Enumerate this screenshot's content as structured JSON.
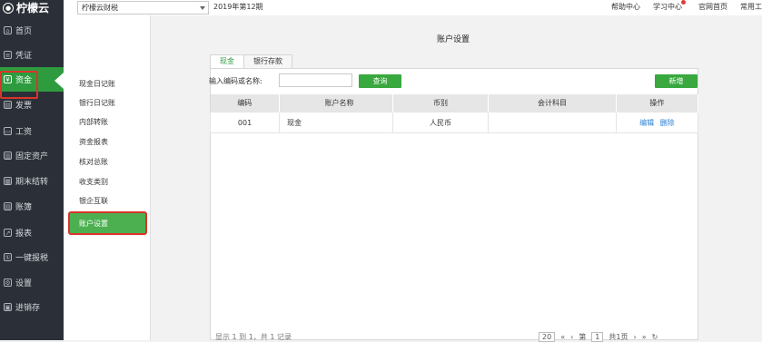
{
  "app": {
    "logo_text": "柠檬云"
  },
  "sidebar": {
    "items": [
      {
        "label": "首页",
        "icon": "home-icon",
        "glyph": "⌂"
      },
      {
        "label": "凭证",
        "icon": "voucher-icon",
        "glyph": "≡"
      },
      {
        "label": "资金",
        "icon": "funds-icon",
        "glyph": "¥"
      },
      {
        "label": "发票",
        "icon": "invoice-icon",
        "glyph": "▤"
      },
      {
        "label": "工资",
        "icon": "salary-icon",
        "glyph": "▭"
      },
      {
        "label": "固定资产",
        "icon": "assets-icon",
        "glyph": "▥"
      },
      {
        "label": "期末结转",
        "icon": "period-end-icon",
        "glyph": "▦"
      },
      {
        "label": "账簿",
        "icon": "ledger-icon",
        "glyph": "▤"
      },
      {
        "label": "报表",
        "icon": "report-icon",
        "glyph": "↗"
      },
      {
        "label": "一键报税",
        "icon": "tax-icon",
        "glyph": "①"
      },
      {
        "label": "设置",
        "icon": "settings-icon",
        "glyph": "⚙"
      },
      {
        "label": "进销存",
        "icon": "inventory-icon",
        "glyph": "▣"
      }
    ]
  },
  "topbar": {
    "company": "柠檬云财税",
    "period": "2019年第12期",
    "links": [
      "帮助中心",
      "学习中心",
      "官网首页",
      "常用工"
    ]
  },
  "submenu": {
    "items": [
      "现金日记账",
      "银行日记账",
      "内部转账",
      "资金报表",
      "核对总账",
      "收支类别",
      "银企互联"
    ],
    "active": "账户设置"
  },
  "main": {
    "title": "账户设置",
    "tabs": [
      "现金",
      "银行存款"
    ],
    "search_label": "输入编码或名称:",
    "search_value": "",
    "query_button": "查询",
    "add_button": "新增",
    "table": {
      "headers": [
        "编码",
        "账户名称",
        "币别",
        "会计科目",
        "操作"
      ],
      "rows": [
        {
          "code": "001",
          "name": "现金",
          "currency": "人民币",
          "subject": "",
          "edit": "编辑",
          "delete": "删除"
        }
      ]
    },
    "footer_text": "显示 1 到 1，共 1 记录",
    "pager": {
      "page_size": "20",
      "page_label": "第",
      "page": "1",
      "total_label": "共1页"
    }
  },
  "colors": {
    "sidebar_bg": "#2b3038",
    "accent_green": "#38a83f",
    "highlight_red": "#d9352a",
    "link_blue": "#2d7fd3"
  }
}
